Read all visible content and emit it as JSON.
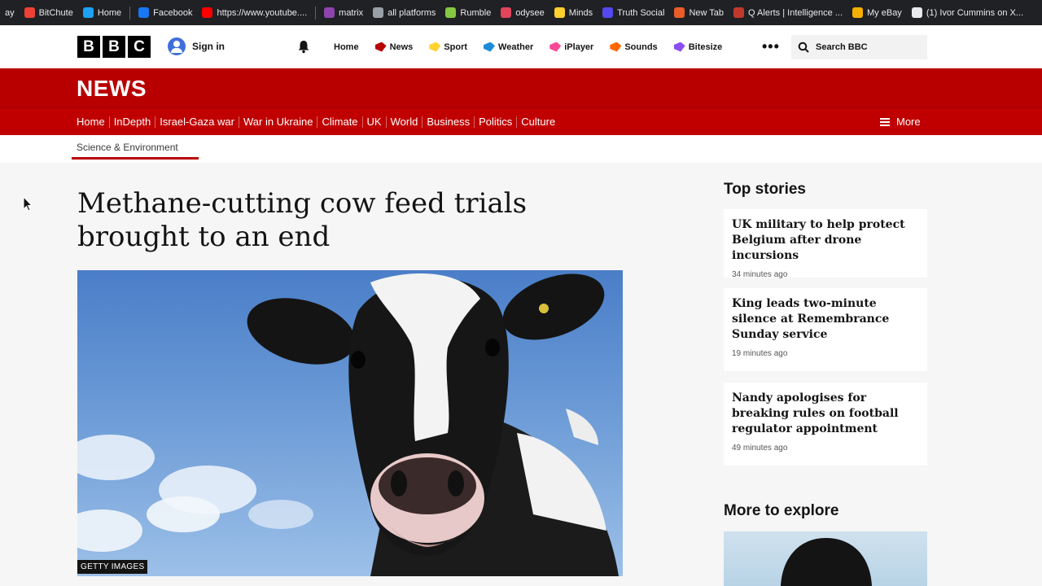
{
  "bookmarks": [
    {
      "label": "ay",
      "color": "#202124"
    },
    {
      "label": "BitChute",
      "color": "#ef4136"
    },
    {
      "label": "Home",
      "color": "#1da1f2"
    },
    {
      "label": "Facebook",
      "color": "#1877f2"
    },
    {
      "label": "https://www.youtube....",
      "color": "#ff0000"
    },
    {
      "label": "matrix",
      "color": "#8e44ad"
    },
    {
      "label": "all platforms",
      "color": "#9aa0a6"
    },
    {
      "label": "Rumble",
      "color": "#85c742"
    },
    {
      "label": "odysee",
      "color": "#e2445c"
    },
    {
      "label": "Minds",
      "color": "#fed12f"
    },
    {
      "label": "Truth Social",
      "color": "#5448ee"
    },
    {
      "label": "New Tab",
      "color": "#e85d2a"
    },
    {
      "label": "Q Alerts | Intelligence ...",
      "color": "#c0392b"
    },
    {
      "label": "My eBay",
      "color": "#f5af02"
    },
    {
      "label": "(1) Ivor Cummins on X...",
      "color": "#e8eaed"
    }
  ],
  "masthead": {
    "logo": [
      "B",
      "B",
      "C"
    ],
    "signin": "Sign in",
    "nav": [
      {
        "label": "Home",
        "color": "#141414"
      },
      {
        "label": "News",
        "color": "#b80000"
      },
      {
        "label": "Sport",
        "color": "#ffd230"
      },
      {
        "label": "Weather",
        "color": "#1c8bd8"
      },
      {
        "label": "iPlayer",
        "color": "#f54997"
      },
      {
        "label": "Sounds",
        "color": "#ff6600"
      },
      {
        "label": "Bitesize",
        "color": "#8c4df0"
      }
    ],
    "more": "•••",
    "search_placeholder": "Search BBC"
  },
  "news": {
    "title": "NEWS",
    "nav": [
      "Home",
      "InDepth",
      "Israel-Gaza war",
      "War in Ukraine",
      "Climate",
      "UK",
      "World",
      "Business",
      "Politics",
      "Culture"
    ],
    "more": "More",
    "section": "Science & Environment"
  },
  "article": {
    "headline": "Methane-cutting cow feed trials brought to an end",
    "image_credit": "GETTY IMAGES"
  },
  "sidebar": {
    "top_stories_heading": "Top stories",
    "stories": [
      {
        "title": "UK military to help protect Belgium after drone incursions",
        "time": "34 minutes ago"
      },
      {
        "title": "King leads two-minute silence at Remembrance Sunday service",
        "time": "19 minutes ago"
      },
      {
        "title": "Nandy apologises for breaking rules on football regulator appointment",
        "time": "49 minutes ago"
      }
    ],
    "explore_heading": "More to explore"
  },
  "colors": {
    "bbc_red": "#b80000",
    "news_nav_red": "#c00000",
    "page_bg": "#f6f6f6"
  }
}
